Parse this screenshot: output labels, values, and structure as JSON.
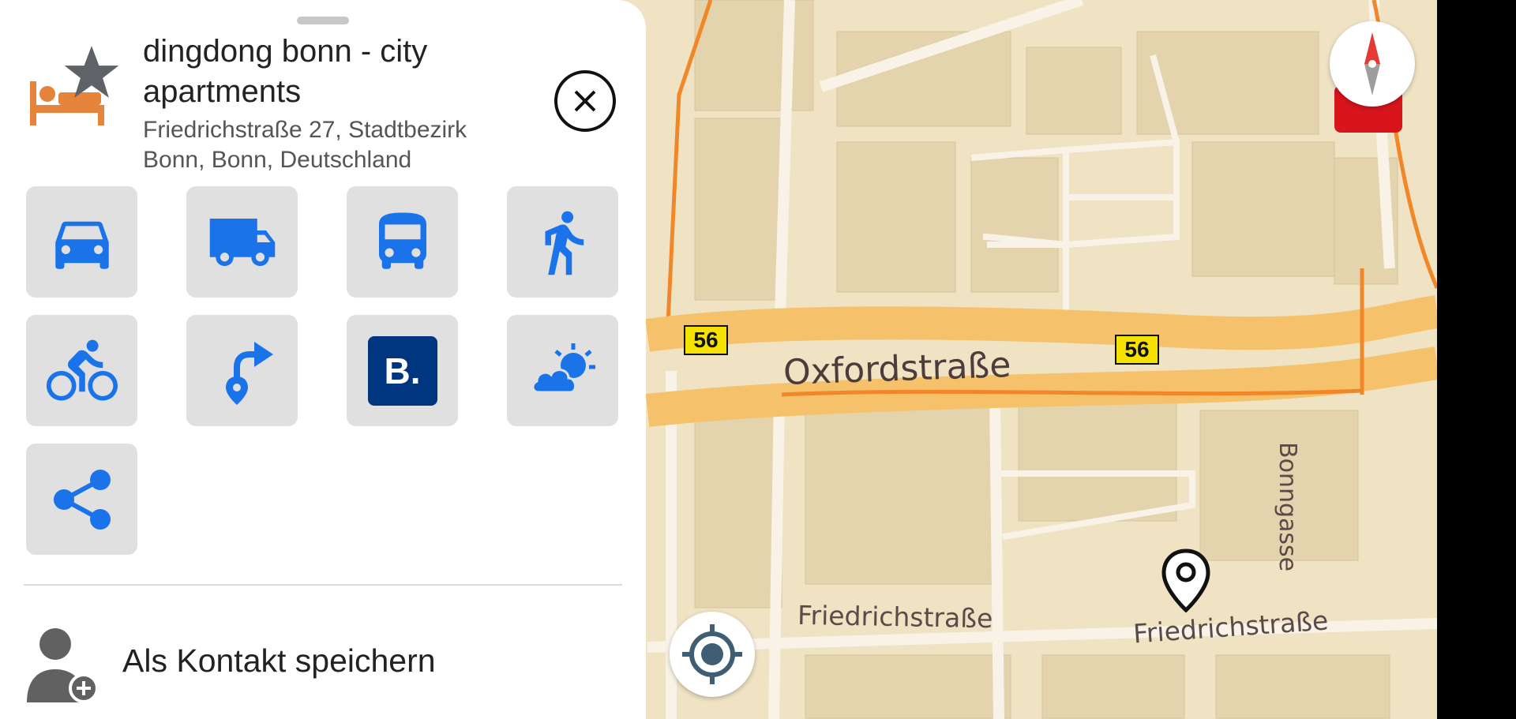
{
  "place": {
    "title": "dingdong bonn - city apartments",
    "address": "Friedrichstraße 27, Stadtbezirk Bonn, Bonn, Deutschland",
    "category_icon": "hotel-bed-icon",
    "favorite_icon": "star-icon"
  },
  "actions": [
    {
      "name": "car",
      "icon": "car-icon"
    },
    {
      "name": "truck",
      "icon": "truck-icon"
    },
    {
      "name": "bus",
      "icon": "bus-icon"
    },
    {
      "name": "walk",
      "icon": "pedestrian-icon"
    },
    {
      "name": "bicycle",
      "icon": "bicycle-icon"
    },
    {
      "name": "route-from",
      "icon": "route-pin-icon"
    },
    {
      "name": "booking",
      "icon": "booking-logo",
      "glyph": "B."
    },
    {
      "name": "weather",
      "icon": "weather-icon"
    },
    {
      "name": "share",
      "icon": "share-icon"
    }
  ],
  "contact": {
    "label": "Als Kontakt speichern"
  },
  "map": {
    "streets": {
      "oxford": "Oxfordstraße",
      "friedrich_left": "Friedrichstraße",
      "friedrich_right": "Friedrichstraße",
      "bonngasse": "Bonngasse"
    },
    "route_number": "56"
  },
  "colors": {
    "accent_blue": "#1a73e8",
    "icon_orange": "#e5843a",
    "road_orange": "#f5c26b",
    "route_line": "#f0882a"
  }
}
